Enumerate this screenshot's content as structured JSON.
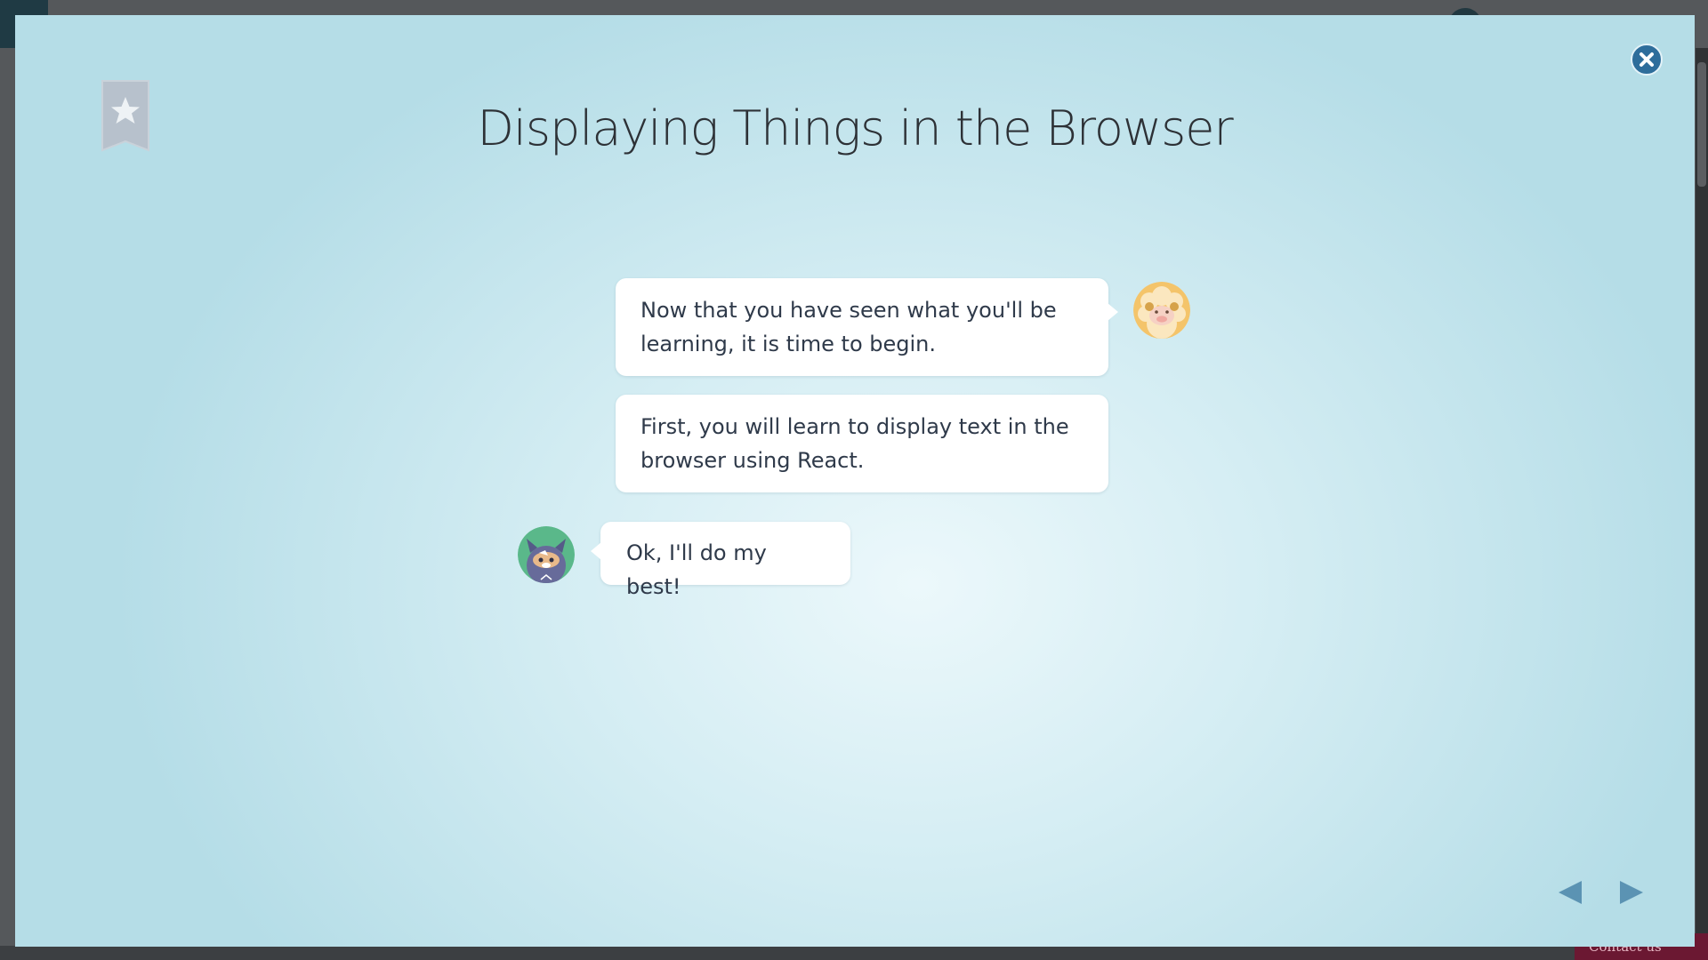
{
  "lesson": {
    "title": "Displaying Things in the Browser"
  },
  "chat": {
    "messages": [
      {
        "speaker": "mentor",
        "text": "Now that you have seen what you'll be learning, it is time to begin."
      },
      {
        "speaker": "mentor",
        "text": "First, you will learn to display text in the browser using React."
      },
      {
        "speaker": "student",
        "text": "Ok, I'll do my best!"
      }
    ]
  },
  "background": {
    "contact_label": "Contact us"
  },
  "icons": {
    "close": "close-icon",
    "bookmark": "bookmark-star-icon",
    "prev": "triangle-left-icon",
    "next": "triangle-right-icon",
    "mentor_avatar": "sheep-avatar",
    "student_avatar": "cat-avatar"
  },
  "colors": {
    "accent": "#2e6d9b",
    "nav_arrow": "#5b93b3",
    "bookmark": "#b7c1cc",
    "text": "#2f3a4a",
    "backdrop": "#b5dde7"
  }
}
